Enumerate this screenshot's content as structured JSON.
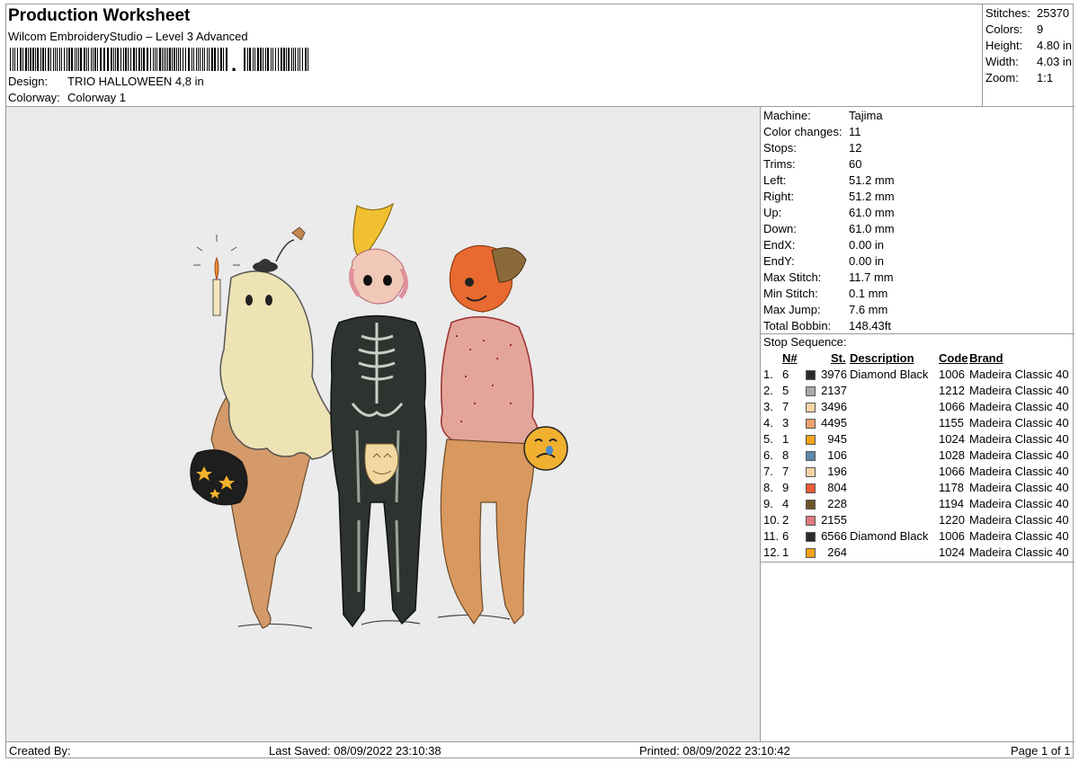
{
  "header": {
    "title": "Production Worksheet",
    "subtitle": "Wilcom EmbroideryStudio – Level 3 Advanced",
    "design_label": "Design:",
    "design_value": "TRIO HALLOWEEN 4,8 in",
    "colorway_label": "Colorway:",
    "colorway_value": "Colorway 1"
  },
  "summary": [
    {
      "label": "Stitches:",
      "value": "25370"
    },
    {
      "label": "Colors:",
      "value": "9"
    },
    {
      "label": "Height:",
      "value": "4.80 in"
    },
    {
      "label": "Width:",
      "value": "4.03 in"
    },
    {
      "label": "Zoom:",
      "value": "1:1"
    }
  ],
  "machine": [
    {
      "label": "Machine:",
      "value": "Tajima"
    },
    {
      "label": "Color changes:",
      "value": "11"
    },
    {
      "label": "Stops:",
      "value": "12"
    },
    {
      "label": "Trims:",
      "value": "60"
    },
    {
      "label": "Left:",
      "value": "51.2 mm"
    },
    {
      "label": "Right:",
      "value": "51.2 mm"
    },
    {
      "label": "Up:",
      "value": "61.0 mm"
    },
    {
      "label": "Down:",
      "value": "61.0 mm"
    },
    {
      "label": "EndX:",
      "value": "0.00 in"
    },
    {
      "label": "EndY:",
      "value": "0.00 in"
    },
    {
      "label": "Max Stitch:",
      "value": "11.7 mm"
    },
    {
      "label": "Min Stitch:",
      "value": "0.1 mm"
    },
    {
      "label": "Max Jump:",
      "value": "7.6 mm"
    },
    {
      "label": "Total Bobbin:",
      "value": "148.43ft"
    }
  ],
  "stop_sequence": {
    "title": "Stop Sequence:",
    "headers": {
      "n": "N#",
      "st": "St.",
      "desc": "Description",
      "code": "Code",
      "brand": "Brand"
    },
    "rows": [
      {
        "idx": "1.",
        "n": "6",
        "color": "#2b2b2b",
        "st": "3976",
        "desc": "Diamond Black",
        "code": "1006",
        "brand": "Madeira Classic 40"
      },
      {
        "idx": "2.",
        "n": "5",
        "color": "#a8aaa9",
        "st": "2137",
        "desc": "",
        "code": "1212",
        "brand": "Madeira Classic 40"
      },
      {
        "idx": "3.",
        "n": "7",
        "color": "#f5d3a6",
        "st": "3496",
        "desc": "",
        "code": "1066",
        "brand": "Madeira Classic 40"
      },
      {
        "idx": "4.",
        "n": "3",
        "color": "#f0a06a",
        "st": "4495",
        "desc": "",
        "code": "1155",
        "brand": "Madeira Classic 40"
      },
      {
        "idx": "5.",
        "n": "1",
        "color": "#f5a21a",
        "st": "945",
        "desc": "",
        "code": "1024",
        "brand": "Madeira Classic 40"
      },
      {
        "idx": "6.",
        "n": "8",
        "color": "#5b88ac",
        "st": "106",
        "desc": "",
        "code": "1028",
        "brand": "Madeira Classic 40"
      },
      {
        "idx": "7.",
        "n": "7",
        "color": "#f5d3a6",
        "st": "196",
        "desc": "",
        "code": "1066",
        "brand": "Madeira Classic 40"
      },
      {
        "idx": "8.",
        "n": "9",
        "color": "#ea5a34",
        "st": "804",
        "desc": "",
        "code": "1178",
        "brand": "Madeira Classic 40"
      },
      {
        "idx": "9.",
        "n": "4",
        "color": "#6b5428",
        "st": "228",
        "desc": "",
        "code": "1194",
        "brand": "Madeira Classic 40"
      },
      {
        "idx": "10.",
        "n": "2",
        "color": "#e07a80",
        "st": "2155",
        "desc": "",
        "code": "1220",
        "brand": "Madeira Classic 40"
      },
      {
        "idx": "11.",
        "n": "6",
        "color": "#2b2b2b",
        "st": "6566",
        "desc": "Diamond Black",
        "code": "1006",
        "brand": "Madeira Classic 40"
      },
      {
        "idx": "12.",
        "n": "1",
        "color": "#f5a21a",
        "st": "264",
        "desc": "",
        "code": "1024",
        "brand": "Madeira Classic 40"
      }
    ]
  },
  "footer": {
    "created_by": "Created By:",
    "last_saved": "Last Saved: 08/09/2022 23:10:38",
    "printed": "Printed: 08/09/2022 23:10:42",
    "page": "Page 1 of 1"
  }
}
